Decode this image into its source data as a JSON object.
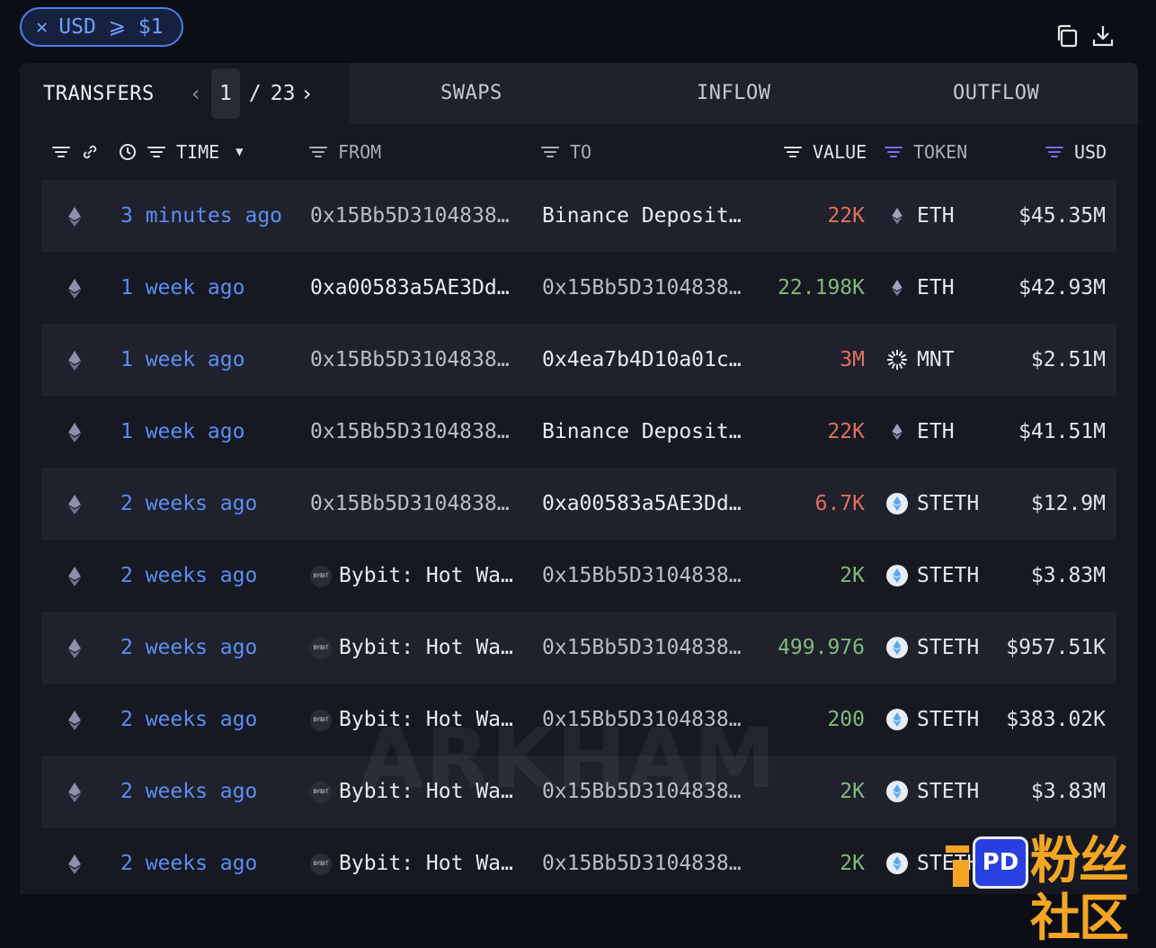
{
  "filter": {
    "text": "USD ⩾ $1"
  },
  "tabs": {
    "transfers": "TRANSFERS",
    "swaps": "SWAPS",
    "inflow": "INFLOW",
    "outflow": "OUTFLOW",
    "page_current": "1",
    "page_sep": "/",
    "page_total": "23"
  },
  "columns": {
    "time": "TIME",
    "from": "FROM",
    "to": "TO",
    "value": "VALUE",
    "token": "TOKEN",
    "usd": "USD"
  },
  "colors": {
    "red": "#e3705f",
    "green": "#82b97c",
    "link": "#5b8ef3",
    "accent": "#7b6cf0"
  },
  "rows": [
    {
      "time": "3 minutes ago",
      "from": "0x15Bb5D3104838…",
      "from_entity": false,
      "to": "Binance Deposit…",
      "value": "22K",
      "dir": "red",
      "token": "ETH",
      "usd": "$45.35M"
    },
    {
      "time": "1 week ago",
      "from": "0xa00583a5AE3Dd…",
      "from_entity": false,
      "to": "0x15Bb5D3104838…",
      "value": "22.198K",
      "dir": "green",
      "token": "ETH",
      "usd": "$42.93M"
    },
    {
      "time": "1 week ago",
      "from": "0x15Bb5D3104838…",
      "from_entity": false,
      "to": "0x4ea7b4D10a01c…",
      "value": "3M",
      "dir": "red",
      "token": "MNT",
      "usd": "$2.51M"
    },
    {
      "time": "1 week ago",
      "from": "0x15Bb5D3104838…",
      "from_entity": false,
      "to": "Binance Deposit…",
      "value": "22K",
      "dir": "red",
      "token": "ETH",
      "usd": "$41.51M"
    },
    {
      "time": "2 weeks ago",
      "from": "0x15Bb5D3104838…",
      "from_entity": false,
      "to": "0xa00583a5AE3Dd…",
      "value": "6.7K",
      "dir": "red",
      "token": "STETH",
      "usd": "$12.9M"
    },
    {
      "time": "2 weeks ago",
      "from": "Bybit: Hot Wa…",
      "from_entity": true,
      "to": "0x15Bb5D3104838…",
      "value": "2K",
      "dir": "green",
      "token": "STETH",
      "usd": "$3.83M"
    },
    {
      "time": "2 weeks ago",
      "from": "Bybit: Hot Wa…",
      "from_entity": true,
      "to": "0x15Bb5D3104838…",
      "value": "499.976",
      "dir": "green",
      "token": "STETH",
      "usd": "$957.51K"
    },
    {
      "time": "2 weeks ago",
      "from": "Bybit: Hot Wa…",
      "from_entity": true,
      "to": "0x15Bb5D3104838…",
      "value": "200",
      "dir": "green",
      "token": "STETH",
      "usd": "$383.02K"
    },
    {
      "time": "2 weeks ago",
      "from": "Bybit: Hot Wa…",
      "from_entity": true,
      "to": "0x15Bb5D3104838…",
      "value": "2K",
      "dir": "green",
      "token": "STETH",
      "usd": "$3.83M"
    },
    {
      "time": "2 weeks ago",
      "from": "Bybit: Hot Wa…",
      "from_entity": true,
      "to": "0x15Bb5D3104838…",
      "value": "2K",
      "dir": "green",
      "token": "STETH",
      "usd": ""
    }
  ],
  "bybit_icon_text": "BYBIT",
  "watermark": "ARKHAM",
  "badge": {
    "logo_text": "PD",
    "label": "粉丝社区"
  }
}
